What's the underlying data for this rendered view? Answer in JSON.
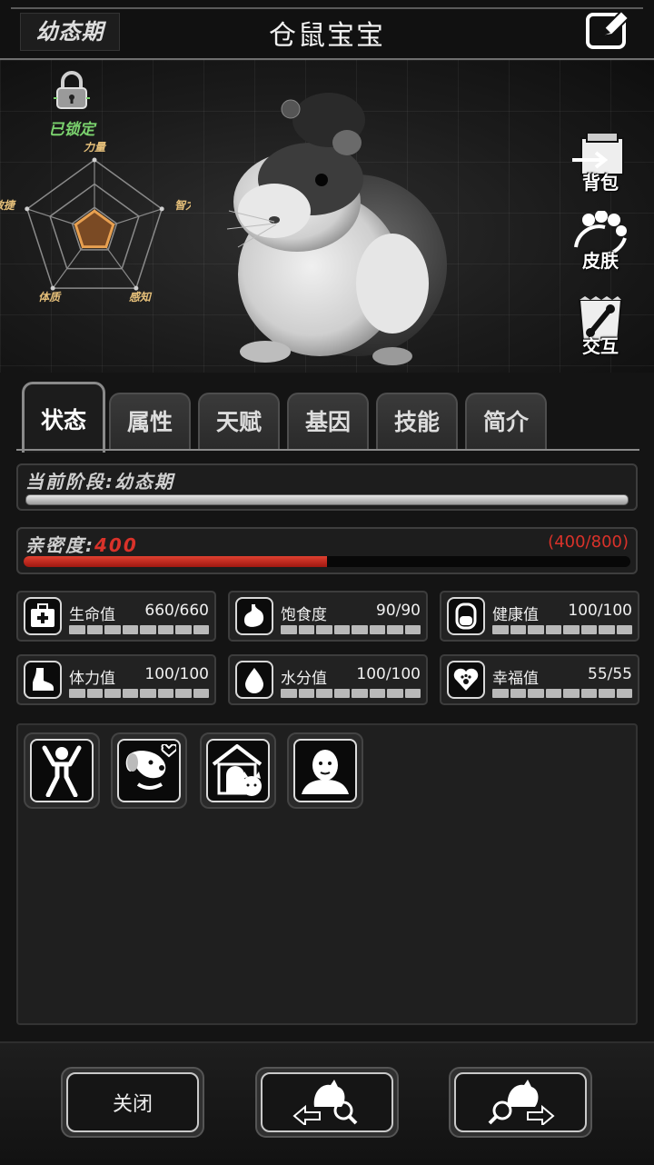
{
  "header": {
    "stage_badge": "幼态期",
    "pet_name": "仓鼠宝宝",
    "edit_icon": "edit-icon"
  },
  "lock": {
    "label": "已锁定",
    "icon": "lock-icon"
  },
  "radar": {
    "labels": [
      "力量",
      "智力",
      "感知",
      "体质",
      "敏捷"
    ],
    "values": [
      0.28,
      0.28,
      0.28,
      0.28,
      0.28
    ],
    "color": "#e8a050"
  },
  "side_buttons": [
    {
      "label": "背包",
      "icon": "backpack-icon"
    },
    {
      "label": "皮肤",
      "icon": "skin-icon"
    },
    {
      "label": "交互",
      "icon": "interact-icon"
    }
  ],
  "tabs": [
    "状态",
    "属性",
    "天赋",
    "基因",
    "技能",
    "简介"
  ],
  "stage": {
    "text": "当前阶段:幼态期"
  },
  "intimacy": {
    "label": "亲密度:",
    "value": "400",
    "count": "(400/800)",
    "progress": 0.5
  },
  "stats": [
    {
      "name": "生命值",
      "value": "660/660",
      "icon": "medkit-icon"
    },
    {
      "name": "饱食度",
      "value": "90/90",
      "icon": "stomach-icon"
    },
    {
      "name": "健康值",
      "value": "100/100",
      "icon": "shield-icon"
    },
    {
      "name": "体力值",
      "value": "100/100",
      "icon": "foot-icon"
    },
    {
      "name": "水分值",
      "value": "100/100",
      "icon": "water-drop-icon"
    },
    {
      "name": "幸福值",
      "value": "55/55",
      "icon": "heart-paw-icon"
    }
  ],
  "skills": [
    {
      "icon": "cheer-person-icon"
    },
    {
      "icon": "dog-love-icon"
    },
    {
      "icon": "pet-house-icon"
    },
    {
      "icon": "person-avatar-icon"
    }
  ],
  "bottom": {
    "close_label": "关闭",
    "prev_icon": "prev-pet-icon",
    "next_icon": "next-pet-icon"
  },
  "colors": {
    "accent_red": "#d9322a",
    "lock_green": "#7bd36e"
  }
}
